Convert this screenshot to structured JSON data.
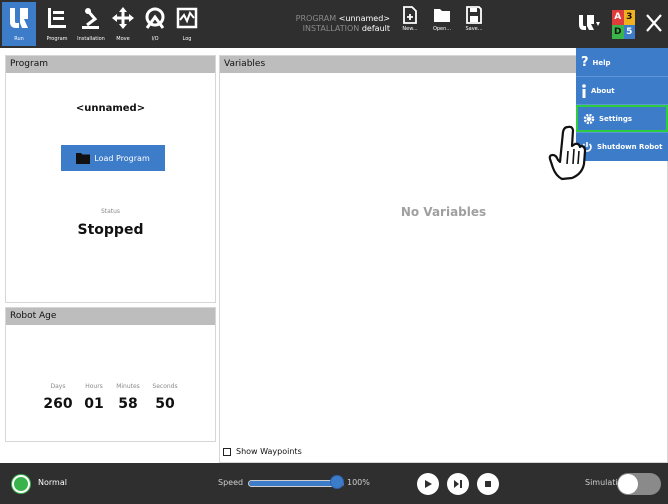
{
  "header": {
    "nav": [
      {
        "label": "Run",
        "icon": "ur-logo-icon",
        "active": true
      },
      {
        "label": "Program",
        "icon": "program-icon"
      },
      {
        "label": "Installation",
        "icon": "robot-arm-icon"
      },
      {
        "label": "Move",
        "icon": "move-arrows-icon"
      },
      {
        "label": "I/O",
        "icon": "io-icon"
      },
      {
        "label": "Log",
        "icon": "log-icon"
      }
    ],
    "program_key": "PROGRAM",
    "program_value": "<unnamed>",
    "installation_key": "INSTALLATION",
    "installation_value": "default",
    "file_buttons": [
      {
        "label": "New...",
        "icon": "new-file-icon"
      },
      {
        "label": "Open...",
        "icon": "folder-icon"
      },
      {
        "label": "Save...",
        "icon": "save-icon"
      }
    ],
    "badge": {
      "a": "A",
      "three": "3",
      "d": "D",
      "five": "5"
    },
    "colors": {
      "bar": "#2f2f2f",
      "accent": "#3d7cc9"
    }
  },
  "program_panel": {
    "title": "Program",
    "program_name": "<unnamed>",
    "load_button": "Load Program",
    "status_label": "Status",
    "status_value": "Stopped"
  },
  "robot_age": {
    "title": "Robot Age",
    "cols": [
      {
        "label": "Days",
        "value": "260"
      },
      {
        "label": "Hours",
        "value": "01"
      },
      {
        "label": "Minutes",
        "value": "58"
      },
      {
        "label": "Seconds",
        "value": "50"
      }
    ]
  },
  "variables_panel": {
    "title": "Variables",
    "empty_text": "No Variables",
    "show_waypoints": "Show Waypoints"
  },
  "menu": {
    "items": [
      {
        "label": "Help",
        "icon": "help-icon"
      },
      {
        "label": "About",
        "icon": "info-icon"
      },
      {
        "label": "Settings",
        "icon": "gear-icon",
        "highlighted": true
      },
      {
        "label": "Shutdown Robot",
        "icon": "power-icon"
      }
    ]
  },
  "footer": {
    "status": "Normal",
    "status_color": "#38b24a",
    "speed_label": "Speed",
    "speed_value": "100%",
    "speed_fraction": 1.0,
    "simulation_label": "Simulation",
    "simulation_on": false
  }
}
